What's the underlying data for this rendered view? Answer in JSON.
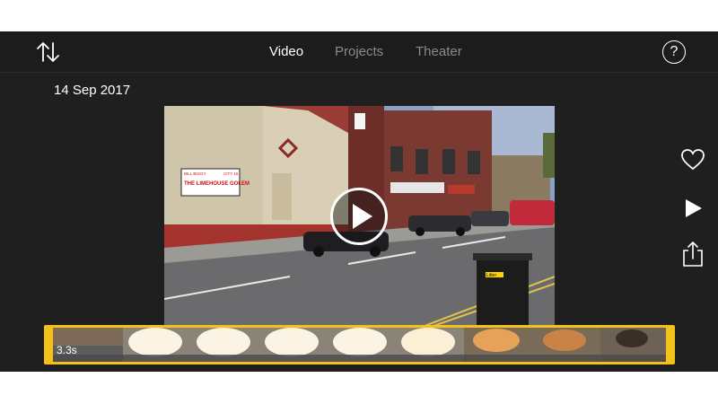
{
  "nav": {
    "tabs": [
      {
        "label": "Video",
        "active": true
      },
      {
        "label": "Projects",
        "active": false
      },
      {
        "label": "Theater",
        "active": false
      }
    ],
    "help_label": "?"
  },
  "clip": {
    "date": "14 Sep 2017",
    "duration": "3.3s"
  },
  "scene": {
    "billboard_top_left": "BILL BIGGY",
    "billboard_top_right": "CITY 16",
    "billboard_title": "THE LIMEHOUSE GOLEM",
    "bin_label": "Litter"
  },
  "icons": {
    "sort": "sort-arrows-icon",
    "help": "help-icon",
    "play_overlay": "play-circle-icon",
    "like": "heart-icon",
    "play": "play-icon",
    "share": "share-icon"
  },
  "colors": {
    "app_background": "#1f1f1f",
    "strip_accent": "#f2c21a",
    "active_tab": "#ffffff",
    "inactive_tab": "#8a8a8a"
  }
}
